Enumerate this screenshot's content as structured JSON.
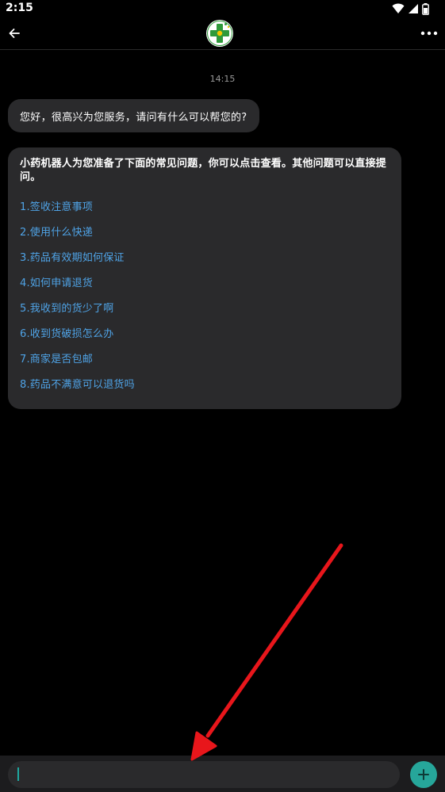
{
  "status_bar": {
    "time": "2:15",
    "icons": [
      "wifi-icon",
      "signal-icon",
      "battery-icon"
    ]
  },
  "toolbar": {
    "back_icon": "arrow-left-icon",
    "logo": "pharmacy-cross-logo",
    "more_icon": "more-horizontal-icon"
  },
  "chat": {
    "timestamp": "14:15",
    "greeting": "您好，很高兴为您服务，请问有什么可以帮您的?",
    "faq_intro": "小药机器人为您准备了下面的常见问题，你可以点击查看。其他问题可以直接提问。",
    "faq_items": [
      "1.签收注意事项",
      "2.使用什么快递",
      "3.药品有效期如何保证",
      "4.如何申请退货",
      "5.我收到的货少了啊",
      "6.收到货破损怎么办",
      "7.商家是否包邮",
      "8.药品不满意可以退货吗"
    ]
  },
  "input_bar": {
    "message_value": "",
    "plus_icon": "plus-icon"
  },
  "colors": {
    "background": "#000000",
    "bubble": "#2a2a2c",
    "link": "#4fa3e6",
    "accent": "#26a69a",
    "annotation_arrow": "#e8161b"
  }
}
